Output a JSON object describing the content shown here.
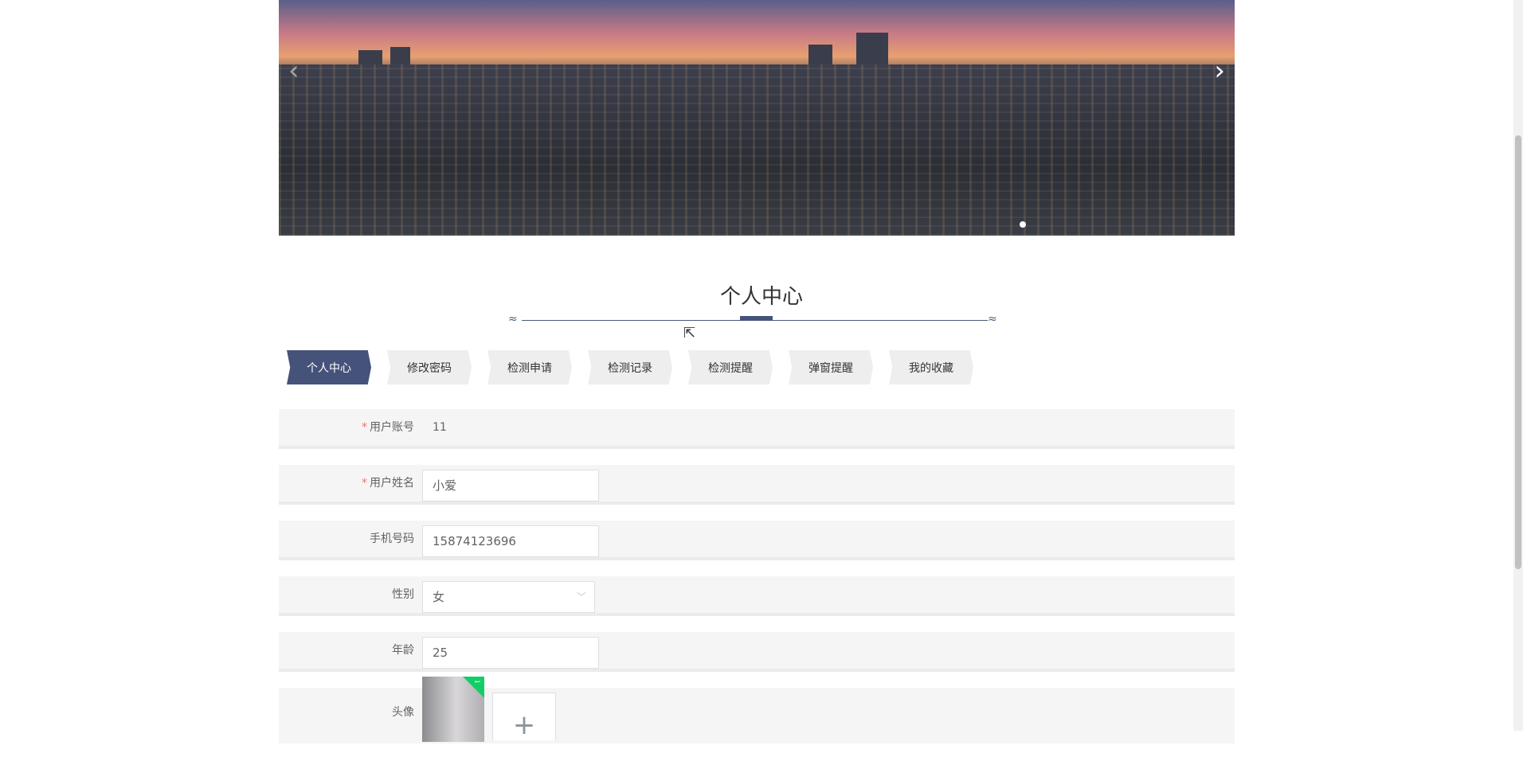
{
  "banner": {
    "prev_icon": "‹",
    "next_icon": "›",
    "slide_count": 1,
    "active_slide": 1
  },
  "page_title": "个人中心",
  "tabs": [
    {
      "label": "个人中心",
      "active": true
    },
    {
      "label": "修改密码"
    },
    {
      "label": "检测申请"
    },
    {
      "label": "检测记录"
    },
    {
      "label": "检测提醒"
    },
    {
      "label": "弹窗提醒"
    },
    {
      "label": "我的收藏"
    }
  ],
  "form": {
    "account": {
      "label": "用户账号",
      "required_mark": "*",
      "value": "11"
    },
    "name": {
      "label": "用户姓名",
      "required_mark": "*",
      "value": "小爱"
    },
    "phone": {
      "label": "手机号码",
      "value": "15874123696"
    },
    "gender": {
      "label": "性别",
      "value": "女"
    },
    "age": {
      "label": "年龄",
      "value": "25"
    },
    "avatar": {
      "label": "头像",
      "upload_icon": "+"
    }
  },
  "colors": {
    "accent": "#45527a",
    "required": "#f56c6c"
  }
}
